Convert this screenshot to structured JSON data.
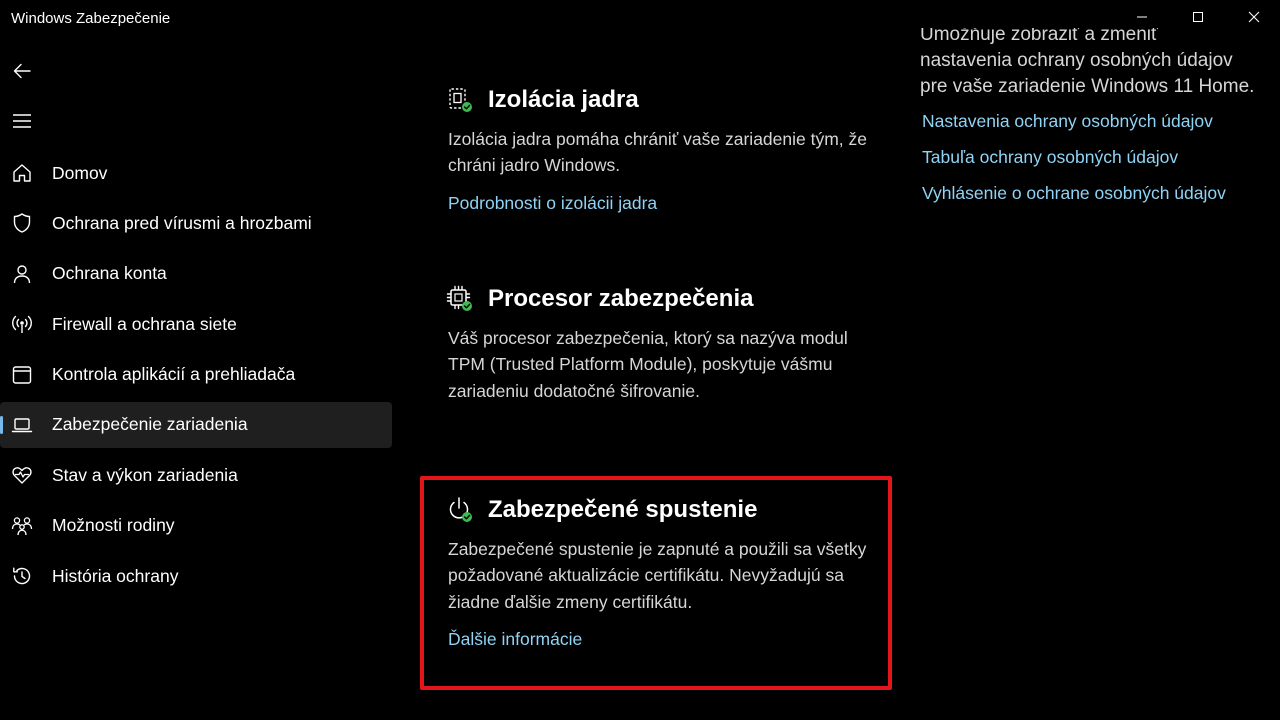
{
  "window": {
    "title": "Windows Zabezpečenie"
  },
  "sidebar": {
    "items": [
      {
        "label": "Domov",
        "icon": "home-icon"
      },
      {
        "label": "Ochrana pred vírusmi a hrozbami",
        "icon": "shield-icon"
      },
      {
        "label": "Ochrana konta",
        "icon": "person-icon"
      },
      {
        "label": "Firewall a ochrana siete",
        "icon": "antenna-icon"
      },
      {
        "label": "Kontrola aplikácií a prehliadača",
        "icon": "app-window-icon"
      },
      {
        "label": "Zabezpečenie zariadenia",
        "icon": "laptop-icon",
        "active": true
      },
      {
        "label": "Stav a výkon zariadenia",
        "icon": "heart-pulse-icon"
      },
      {
        "label": "Možnosti rodiny",
        "icon": "family-icon"
      },
      {
        "label": "História ochrany",
        "icon": "history-icon"
      }
    ]
  },
  "main": {
    "core_isolation": {
      "title": "Izolácia jadra",
      "desc": "Izolácia jadra pomáha chrániť vaše zariadenie tým, že chráni jadro Windows.",
      "link": "Podrobnosti o izolácii jadra"
    },
    "security_processor": {
      "title": "Procesor zabezpečenia",
      "desc": "Váš procesor zabezpečenia, ktorý sa nazýva modul TPM (Trusted Platform Module), poskytuje vášmu zariadeniu dodatočné šifrovanie."
    },
    "secure_boot": {
      "title": "Zabezpečené spustenie",
      "desc": "Zabezpečené spustenie je zapnuté a použili sa všetky požadované aktualizácie certifikátu. Nevyžadujú sa žiadne ďalšie zmeny certifikátu.",
      "link": "Ďalšie informácie"
    }
  },
  "right": {
    "desc_clipped": "Umožňuje zobraziť a zmeniť",
    "desc": "nastavenia ochrany osobných údajov pre vaše zariadenie Windows 11 Home.",
    "links": [
      "Nastavenia ochrany osobných údajov",
      "Tabuľa ochrany osobných údajov",
      "Vyhlásenie o ochrane osobných údajov"
    ]
  },
  "colors": {
    "background": "#000000",
    "link": "#8fd3f5",
    "highlight": "#e3141a",
    "status_ok": "#3fb950"
  }
}
